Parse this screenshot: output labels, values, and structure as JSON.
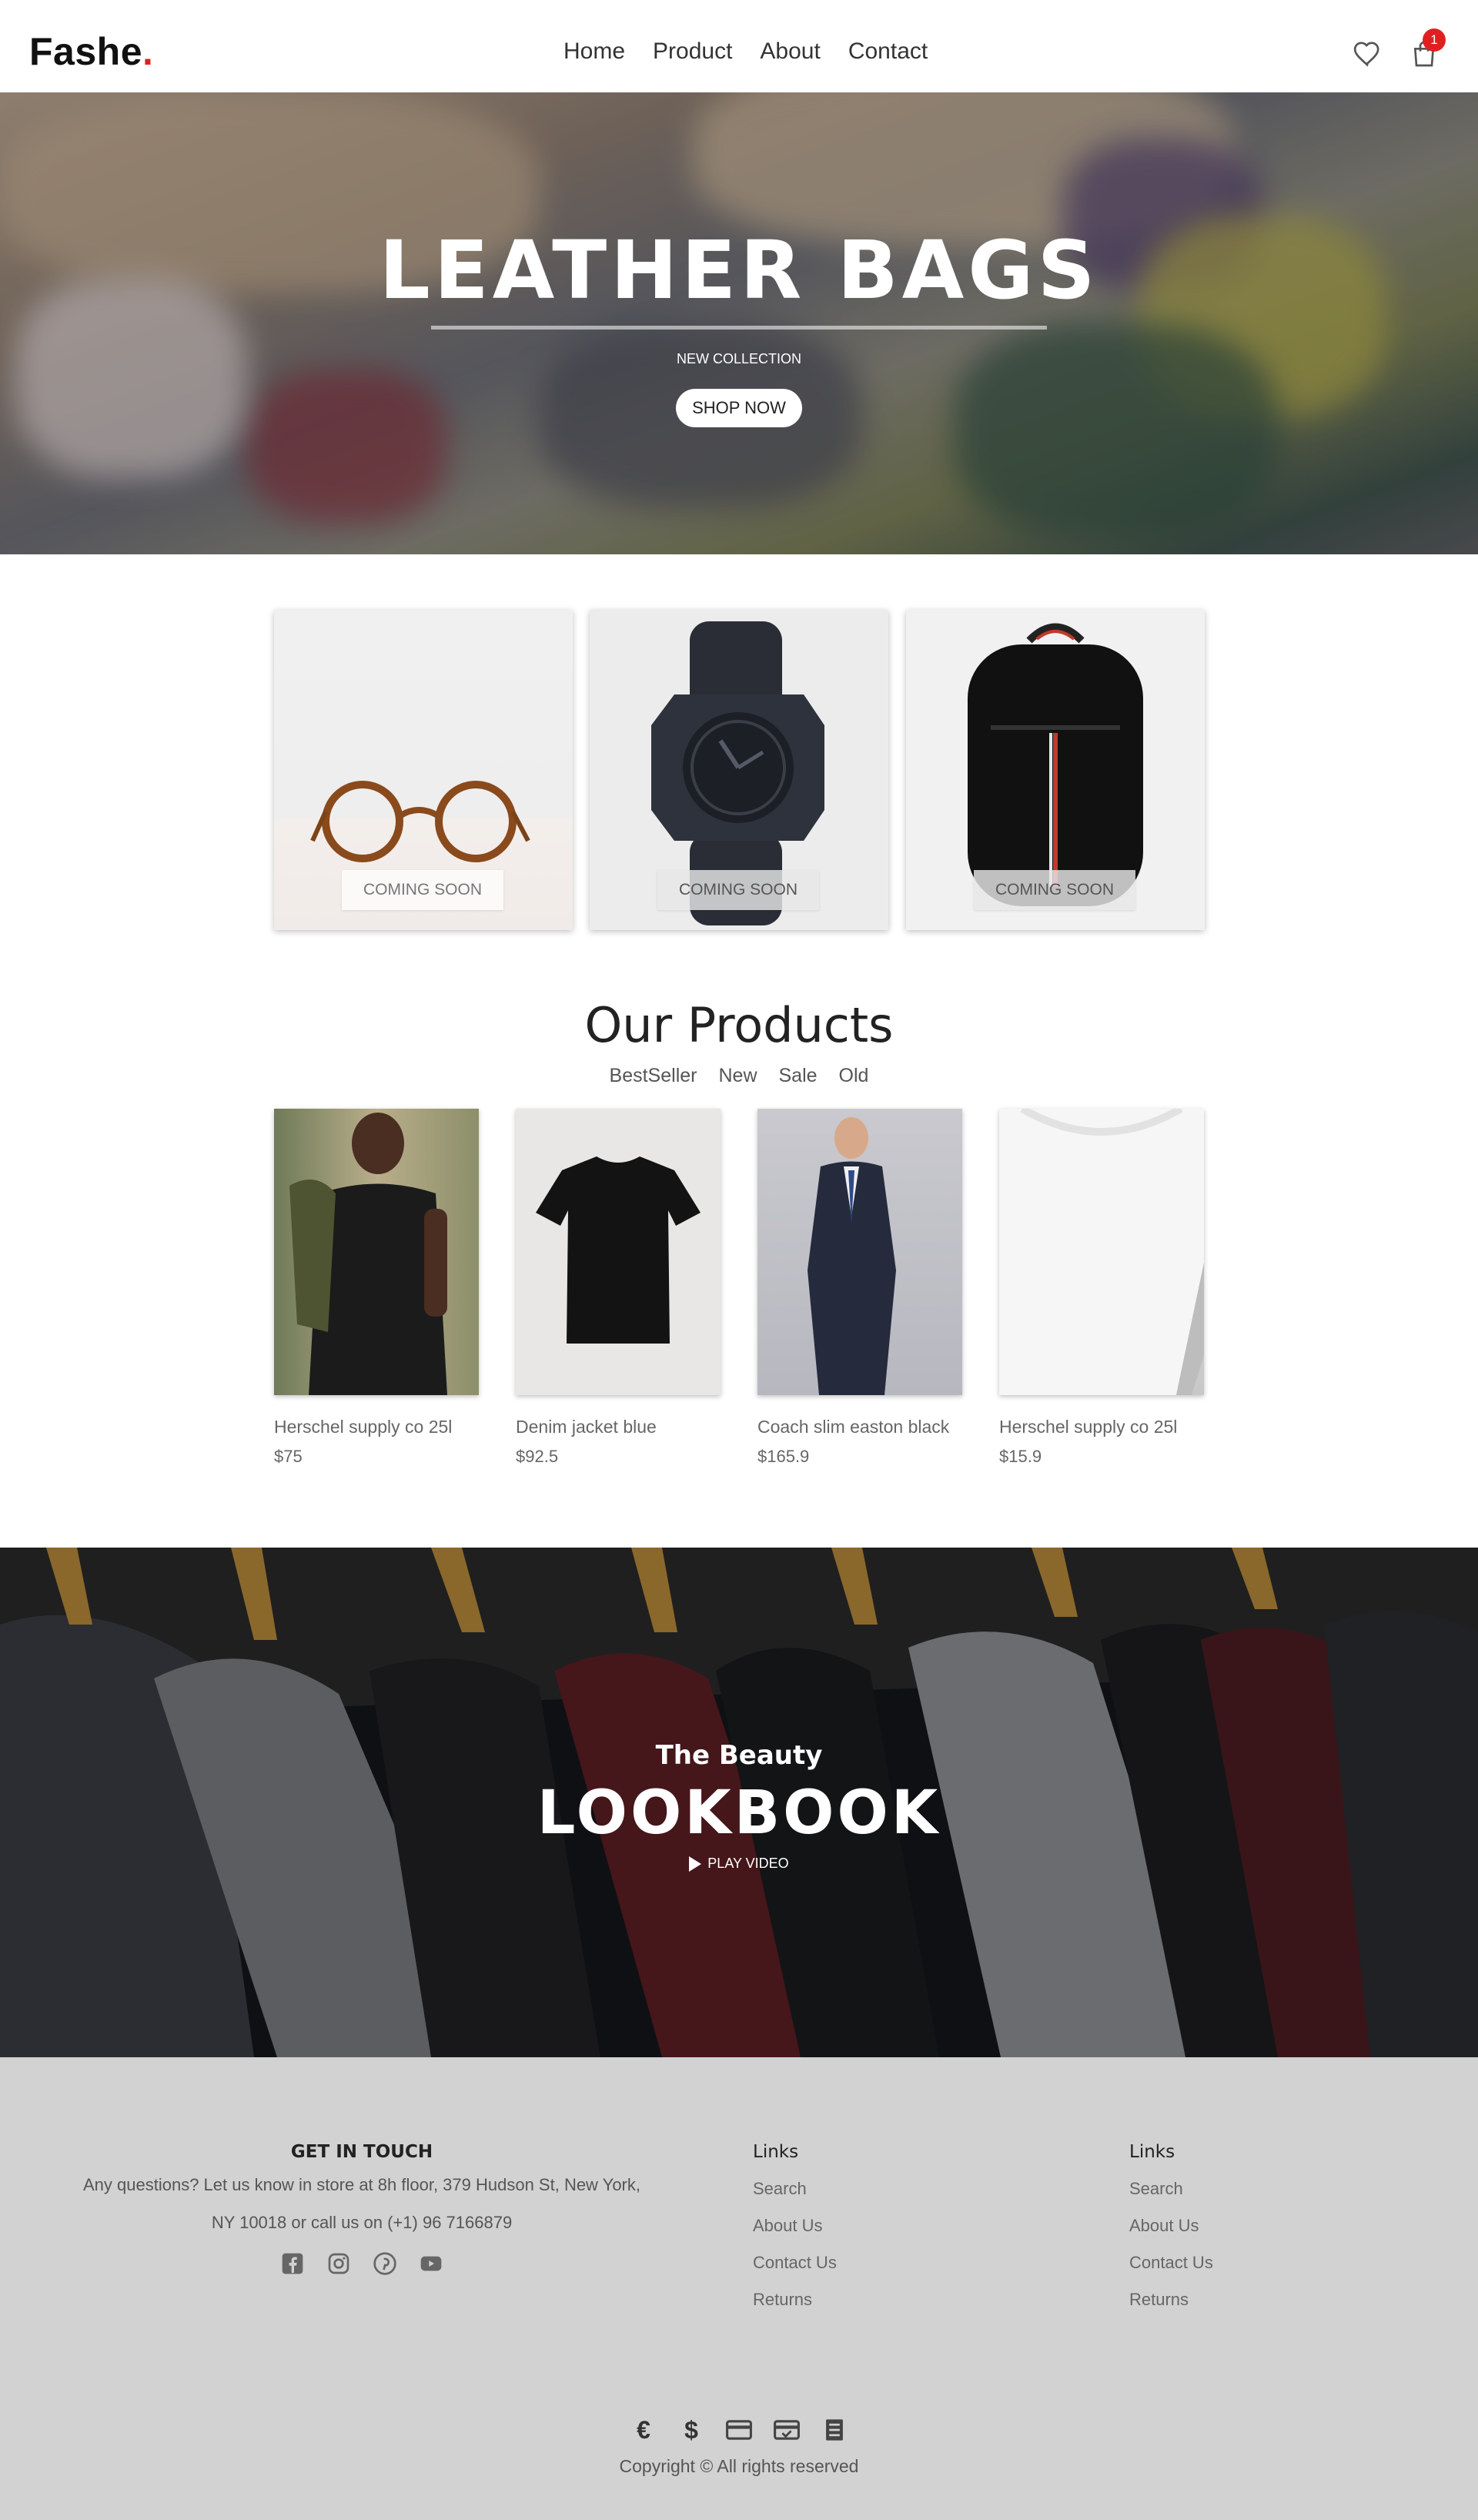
{
  "header": {
    "logo_text": "Fashe",
    "logo_dot": ".",
    "nav": [
      "Home",
      "Product",
      "About",
      "Contact"
    ],
    "cart_count": "1",
    "icons": {
      "wishlist": "heart-icon",
      "cart": "shopping-bag-icon"
    },
    "colors": {
      "accent": "#e02020"
    }
  },
  "hero": {
    "title": "LEATHER BAGS",
    "subtitle": "NEW COLLECTION",
    "button": "SHOP NOW"
  },
  "features": [
    {
      "image": "eyeglasses",
      "label": "COMING SOON"
    },
    {
      "image": "black-watch",
      "label": "COMING SOON"
    },
    {
      "image": "black-backpack",
      "label": "COMING SOON"
    }
  ],
  "products": {
    "title": "Our Products",
    "filters": [
      "BestSeller",
      "New",
      "Sale",
      "Old"
    ],
    "items": [
      {
        "name": "Herschel supply co 25l",
        "price": "$75",
        "image": "man-black-tshirt"
      },
      {
        "name": "Denim jacket blue",
        "price": "$92.5",
        "image": "black-tshirt"
      },
      {
        "name": "Coach slim easton black",
        "price": "$165.9",
        "image": "man-in-suit"
      },
      {
        "name": "Herschel supply co 25l",
        "price": "$15.9",
        "image": "white-tshirt"
      }
    ]
  },
  "lookbook": {
    "subtitle": "The Beauty",
    "title": "LOOKBOOK",
    "play": "PLAY VIDEO"
  },
  "footer": {
    "contact": {
      "heading": "GET IN TOUCH",
      "line1": "Any questions? Let us know in store at 8h floor, 379 Hudson St, New York,",
      "line2": "NY 10018 or call us on (+1) 96 7166879",
      "social": [
        "facebook-icon",
        "instagram-icon",
        "pinterest-icon",
        "youtube-icon"
      ]
    },
    "links1": {
      "heading": "Links",
      "items": [
        "Search",
        "About Us",
        "Contact Us",
        "Returns"
      ]
    },
    "links2": {
      "heading": "Links",
      "items": [
        "Search",
        "About Us",
        "Contact Us",
        "Returns"
      ]
    },
    "payments": {
      "euro": "€",
      "dollar": "$"
    },
    "copyright": "Copyright © All rights reserved"
  }
}
